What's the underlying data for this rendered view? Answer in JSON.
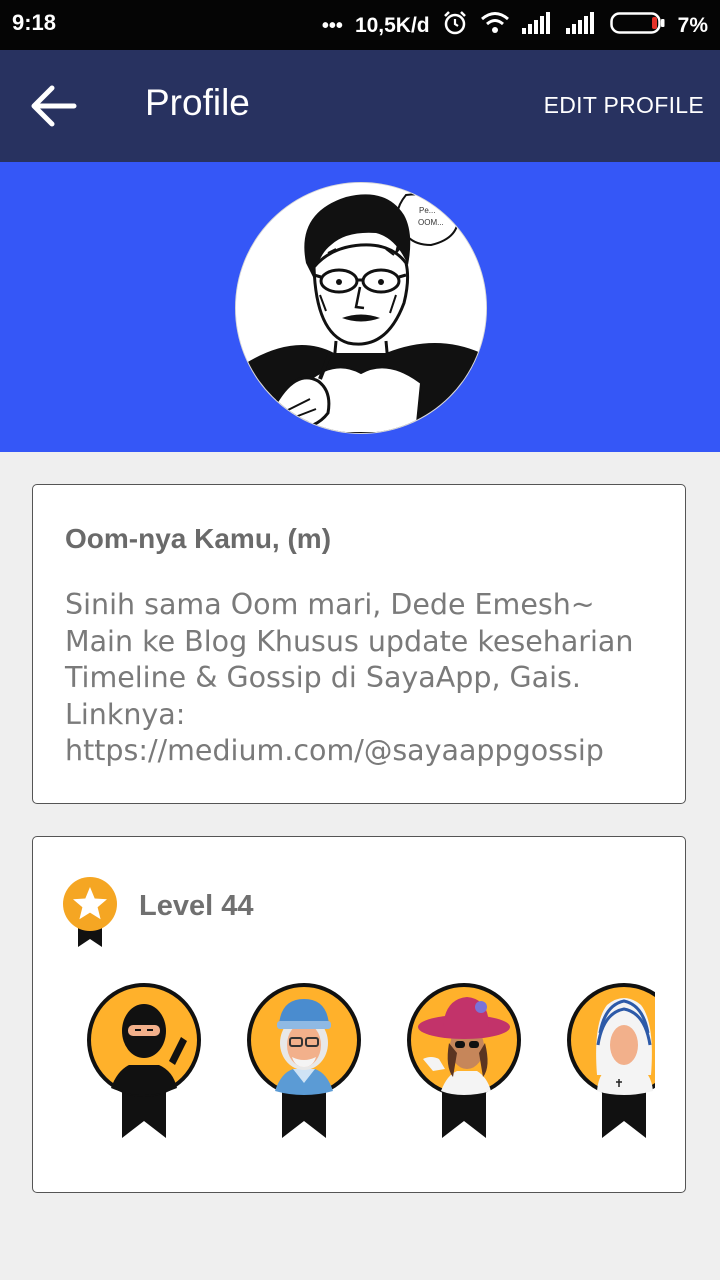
{
  "status_bar": {
    "time": "9:18",
    "dots": "•••",
    "network_speed": "10,5K/d",
    "battery_percent": "7%",
    "icons": [
      "alarm-icon",
      "wifi-icon",
      "signal-icon",
      "signal-icon",
      "battery-icon"
    ]
  },
  "appbar": {
    "title": "Profile",
    "edit_label": "EDIT PROFILE",
    "back_icon": "arrow-left-icon",
    "color": "#283260"
  },
  "banner": {
    "color": "#3557f7"
  },
  "profile": {
    "name": "Oom-nya Kamu, (m)",
    "bio": "Sinih sama Oom mari, Dede Emesh~ Main ke Blog Khusus update keseharian Timeline & Gossip di SayaApp, Gais. Linknya: https://medium.com/@sayaappgossip"
  },
  "level": {
    "label": "Level 44",
    "icon": "star-medal-icon",
    "badges": [
      "ninja-badge",
      "grandpa-badge",
      "lady-hat-badge",
      "nun-badge"
    ]
  },
  "colors": {
    "badge_orange": "#ffb12b",
    "background": "#efefef"
  }
}
